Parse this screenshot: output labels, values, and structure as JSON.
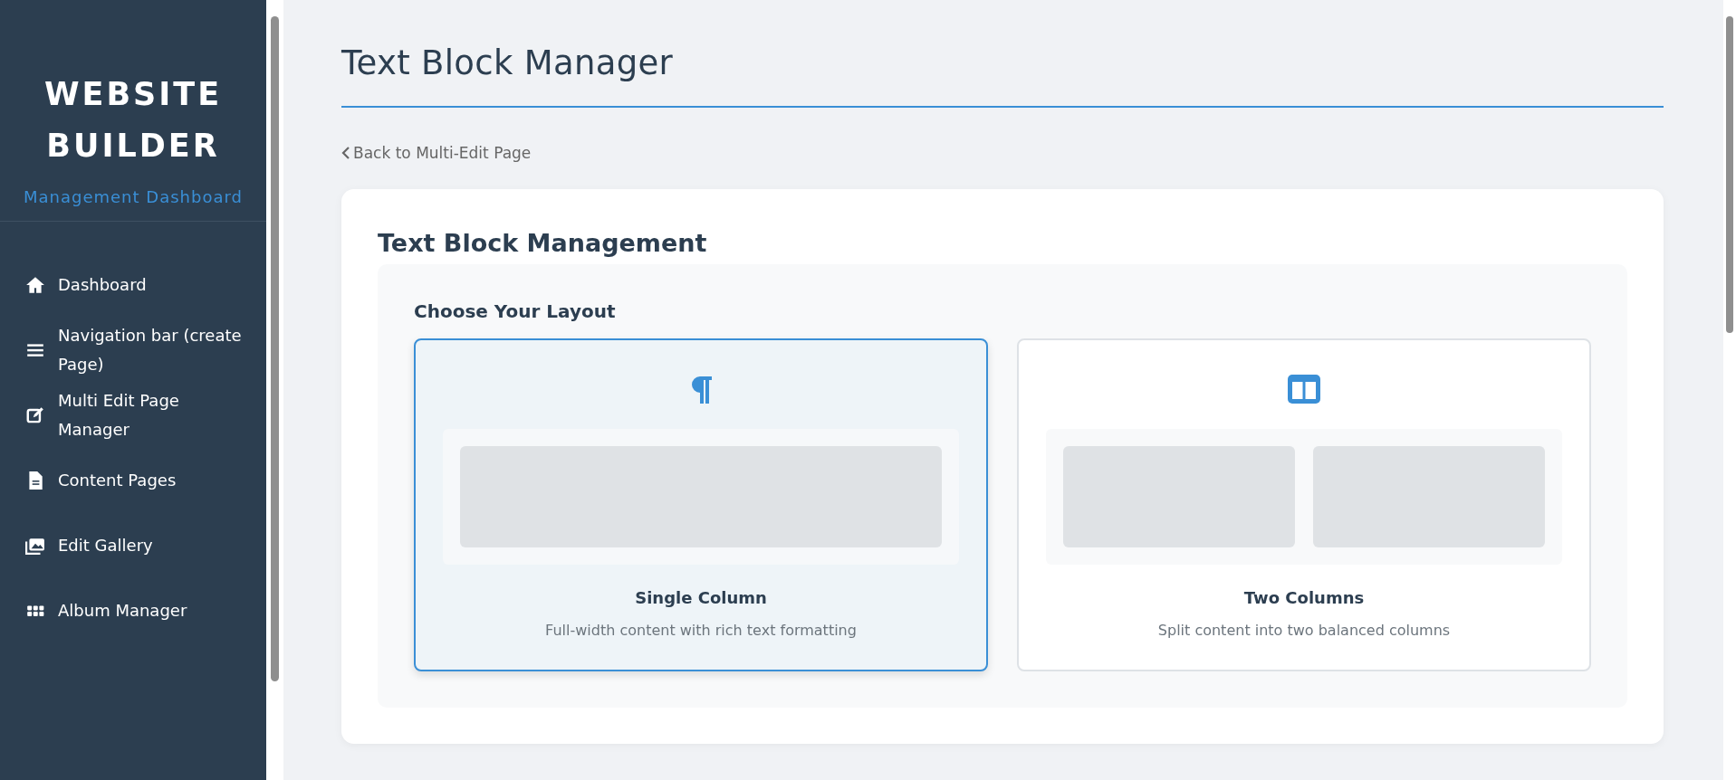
{
  "sidebar": {
    "title": "WEBSITE BUILDER",
    "subtitle": "Management Dashboard",
    "items": [
      {
        "label": "Dashboard"
      },
      {
        "label": "Navigation bar (create Page)"
      },
      {
        "label": "Multi Edit Page Manager"
      },
      {
        "label": "Content Pages"
      },
      {
        "label": "Edit Gallery"
      },
      {
        "label": "Album Manager"
      }
    ]
  },
  "page": {
    "title": "Text Block Manager",
    "back_link": "Back to Multi-Edit Page"
  },
  "card": {
    "heading": "Text Block Management",
    "section_title": "Choose Your Layout",
    "layouts": [
      {
        "kind": "single",
        "title": "Single Column",
        "description": "Full-width content with rich text formatting",
        "selected": true
      },
      {
        "kind": "two",
        "title": "Two Columns",
        "description": "Split content into two balanced columns",
        "selected": false
      }
    ]
  }
}
